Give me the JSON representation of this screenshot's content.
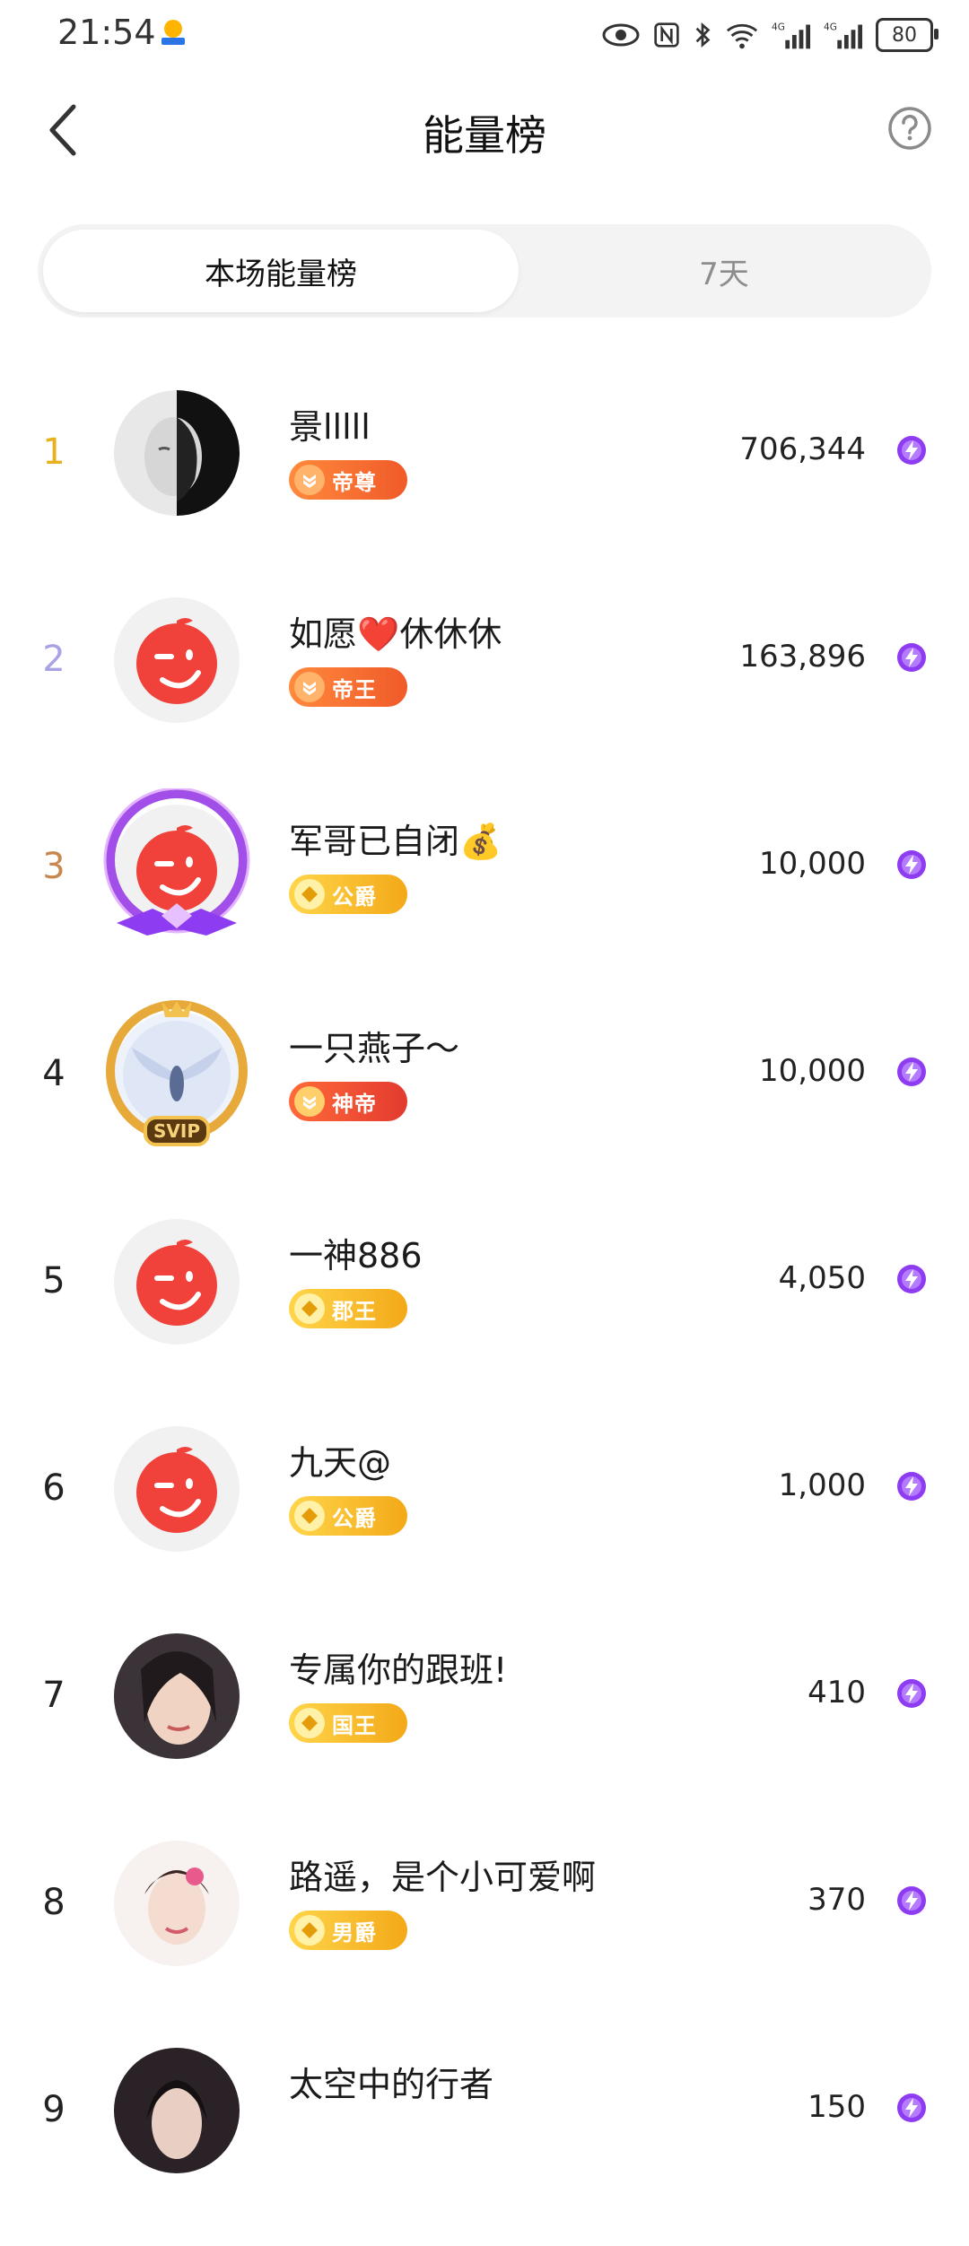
{
  "status_bar": {
    "time": "21:54",
    "battery": "80"
  },
  "nav": {
    "title": "能量榜"
  },
  "tabs": [
    {
      "label": "本场能量榜",
      "active": true
    },
    {
      "label": "7天",
      "active": false
    }
  ],
  "colors": {
    "rank1": "#e8b21c",
    "rank2": "#a9a3e6",
    "rank3": "#c8884d",
    "rank_default": "#222222",
    "energy": "#8e3cf2"
  },
  "rows": [
    {
      "rank": "1",
      "name": "景lllll",
      "badge": "帝尊",
      "badge_style": "orange",
      "score": "706,344",
      "avatar": "bw-face"
    },
    {
      "rank": "2",
      "name": "如愿❤️休休休",
      "badge": "帝王",
      "badge_style": "orange",
      "score": "163,896",
      "avatar": "default-wink"
    },
    {
      "rank": "3",
      "name": "军哥已自闭💰",
      "badge": "公爵",
      "badge_style": "gold",
      "score": "10,000",
      "avatar": "default-wink-purple-frame"
    },
    {
      "rank": "4",
      "name": "一只燕子～",
      "badge": "神帝",
      "badge_style": "red",
      "score": "10,000",
      "avatar": "svip-angel"
    },
    {
      "rank": "5",
      "name": "一神886",
      "badge": "郡王",
      "badge_style": "gold",
      "score": "4,050",
      "avatar": "default-wink"
    },
    {
      "rank": "6",
      "name": "九天@",
      "badge": "公爵",
      "badge_style": "gold",
      "score": "1,000",
      "avatar": "default-wink"
    },
    {
      "rank": "7",
      "name": "专属你的跟班!",
      "badge": "国王",
      "badge_style": "gold",
      "score": "410",
      "avatar": "photo-woman"
    },
    {
      "rank": "8",
      "name": "路遥，是个小可爱啊",
      "badge": "男爵",
      "badge_style": "gold",
      "score": "370",
      "avatar": "photo-girl"
    },
    {
      "rank": "9",
      "name": "太空中的行者",
      "badge": "",
      "badge_style": "gold",
      "score": "150",
      "avatar": "photo-dark"
    }
  ]
}
